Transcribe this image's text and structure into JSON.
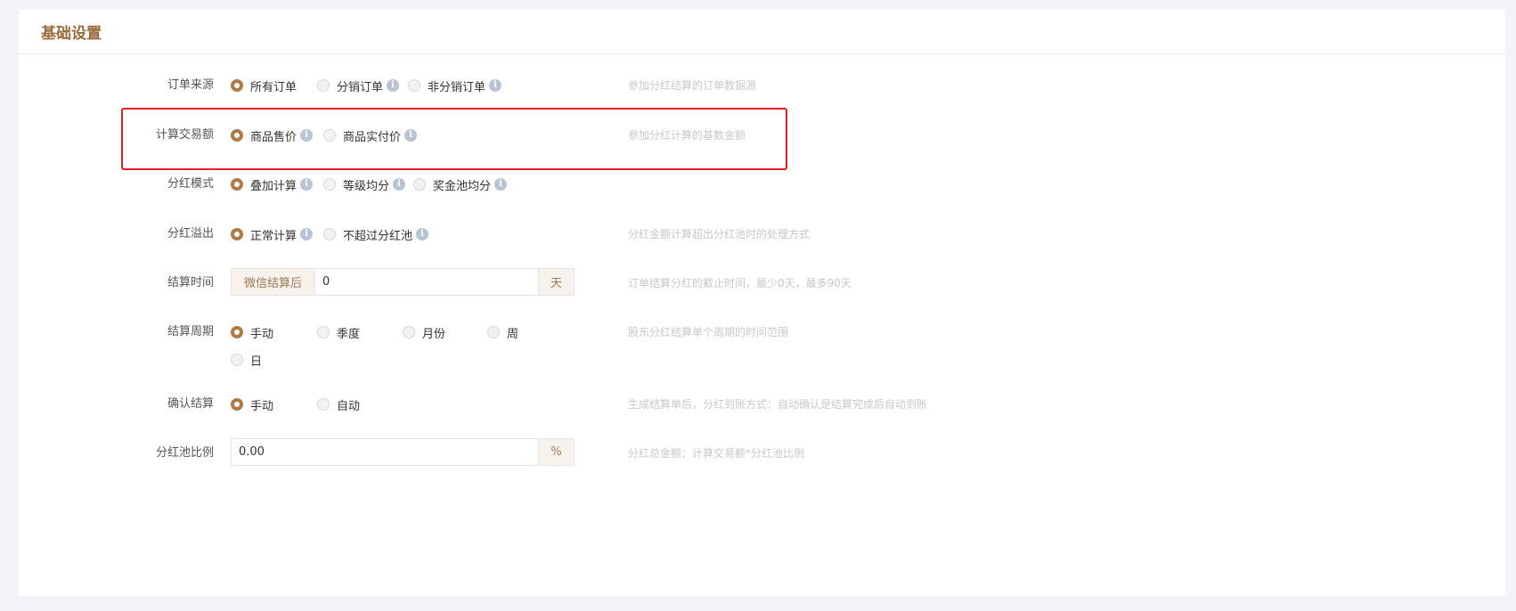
{
  "panel": {
    "title": "基础设置"
  },
  "rows": {
    "order_source": {
      "label": "订单来源",
      "options": [
        "所有订单",
        "分销订单",
        "非分销订单"
      ],
      "selected": "所有订单",
      "hint": "参加分红结算的订单数据源"
    },
    "trade_amount": {
      "label": "计算交易额",
      "options": [
        "商品售价",
        "商品实付价"
      ],
      "selected": "商品售价",
      "hint": "参加分红计算的基数金额"
    },
    "dividend_mode": {
      "label": "分红模式",
      "options": [
        "叠加计算",
        "等级均分",
        "奖金池均分"
      ],
      "selected": "叠加计算",
      "hint": ""
    },
    "dividend_overflow": {
      "label": "分红溢出",
      "options": [
        "正常计算",
        "不超过分红池"
      ],
      "selected": "正常计算",
      "hint": "分红金额计算超出分红池时的处理方式"
    },
    "settle_time": {
      "label": "结算时间",
      "prefix": "微信结算后",
      "value": "0",
      "suffix": "天",
      "hint": "订单结算分红的截止时间，最少0天，最多90天"
    },
    "settle_period": {
      "label": "结算周期",
      "options": [
        "手动",
        "季度",
        "月份",
        "周",
        "日"
      ],
      "selected": "手动",
      "hint": "股东分红结算单个周期的时间范围"
    },
    "confirm_settle": {
      "label": "确认结算",
      "options": [
        "手动",
        "自动"
      ],
      "selected": "手动",
      "hint": "生成结算单后，分红到账方式：自动确认是结算完成后自动到账"
    },
    "pool_ratio": {
      "label": "分红池比例",
      "value": "0.00",
      "suffix": "%",
      "hint": "分红总金额：计算交易额*分红池比例"
    }
  },
  "icons": {
    "info": "info-circle-icon"
  },
  "colors": {
    "accent": "#b07a45",
    "title": "#9a6a3b",
    "highlight": "#e02020"
  }
}
